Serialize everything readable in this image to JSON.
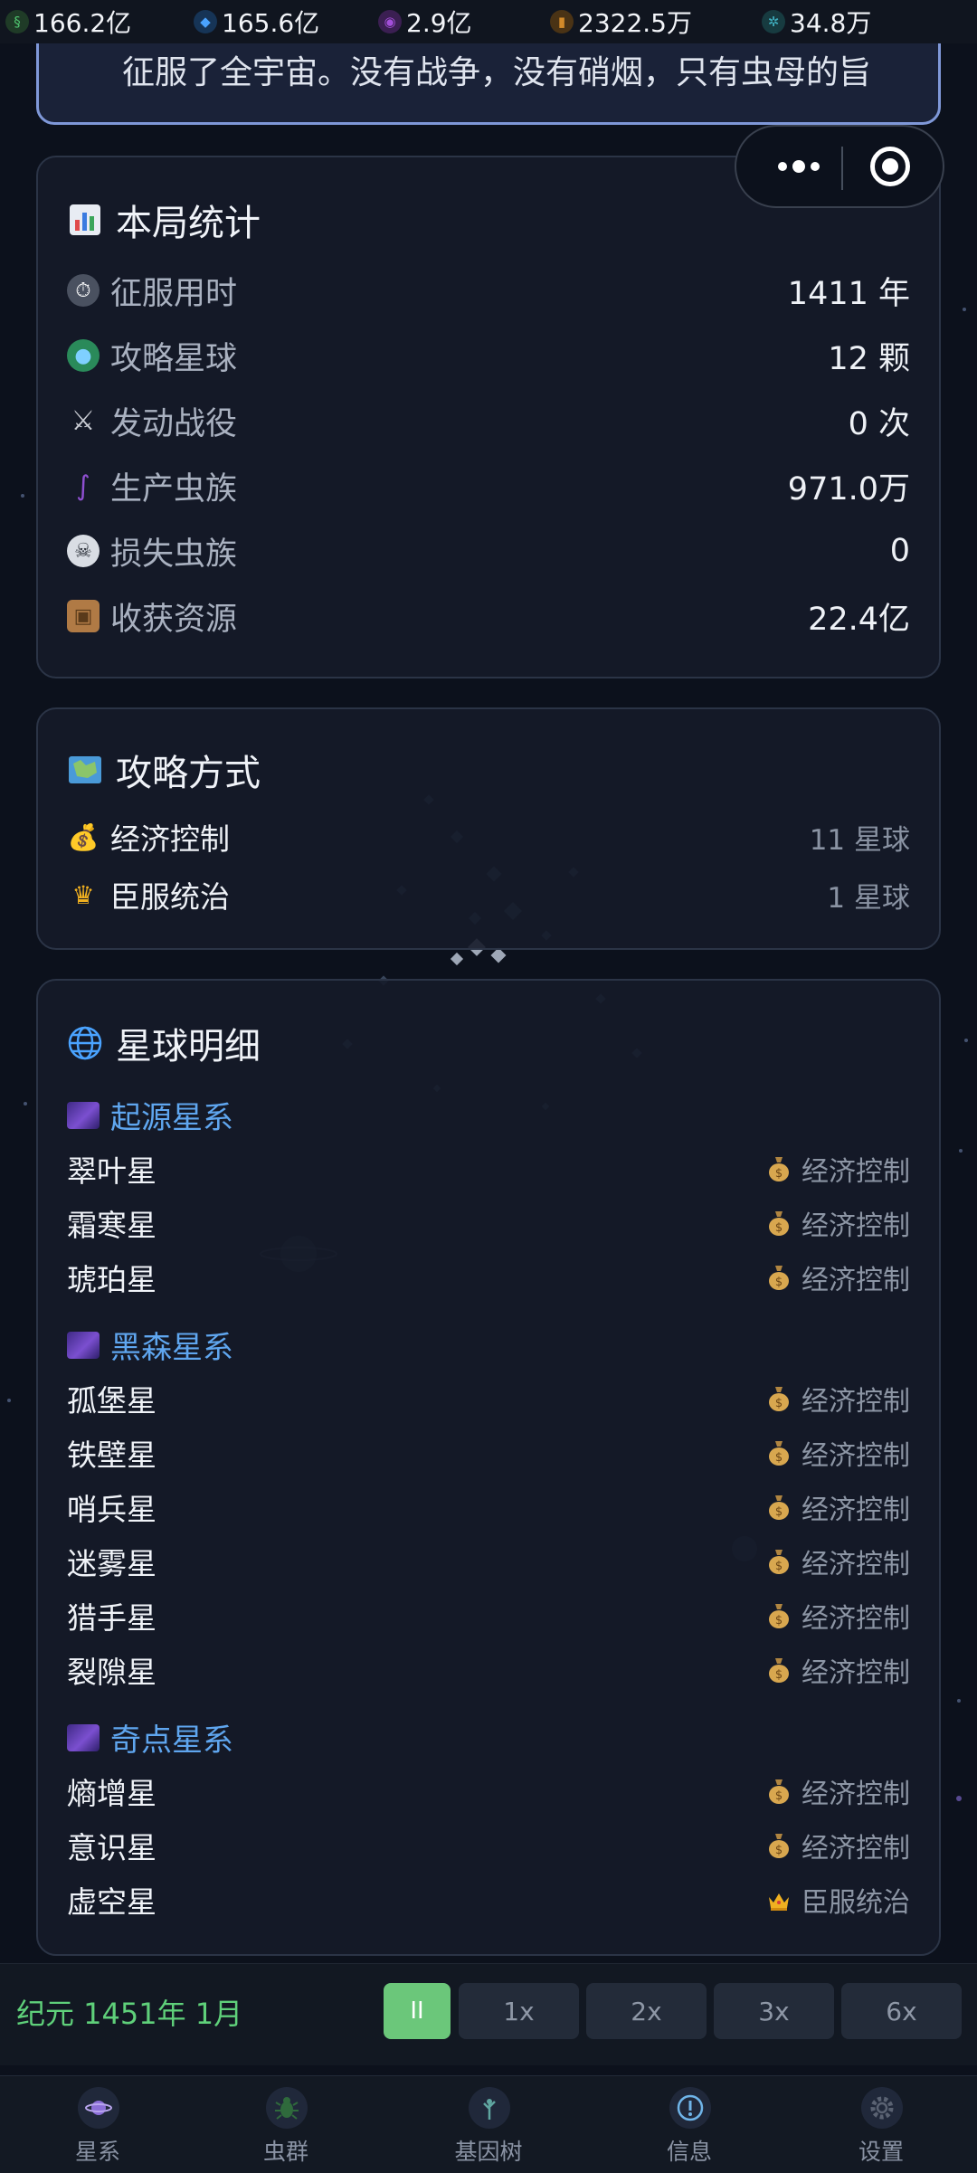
{
  "resources": [
    {
      "icon": "dna-icon",
      "value": "166.2亿",
      "color": "#4fc46f"
    },
    {
      "icon": "crystal-icon",
      "value": "165.6亿",
      "color": "#4aa3ff"
    },
    {
      "icon": "essence-icon",
      "value": "2.9亿",
      "color": "#a34fd9"
    },
    {
      "icon": "mineral-icon",
      "value": "2322.5万",
      "color": "#d28a2a"
    },
    {
      "icon": "gear-resource-icon",
      "value": "34.8万",
      "color": "#3fb0c0"
    }
  ],
  "quote": {
    "text": "征服了全宇宙。没有战争，没有硝烟，只有虫母的旨"
  },
  "stats": {
    "title": "本局统计",
    "rows": [
      {
        "icon": "stopwatch-icon",
        "label": "征服用时",
        "value": "1411 年"
      },
      {
        "icon": "globe-icon",
        "label": "攻略星球",
        "value": "12 颗"
      },
      {
        "icon": "swords-icon",
        "label": "发动战役",
        "value": "0 次"
      },
      {
        "icon": "worm-icon",
        "label": "生产虫族",
        "value": "971.0万"
      },
      {
        "icon": "skull-icon",
        "label": "损失虫族",
        "value": "0"
      },
      {
        "icon": "package-icon",
        "label": "收获资源",
        "value": "22.4亿"
      }
    ]
  },
  "methods": {
    "title": "攻略方式",
    "rows": [
      {
        "icon": "money-bag-icon",
        "label": "经济控制",
        "value": "11 星球"
      },
      {
        "icon": "crown-icon",
        "label": "臣服统治",
        "value": "1 星球"
      }
    ]
  },
  "planets": {
    "title": "星球明细",
    "systems": [
      {
        "name": "起源星系",
        "planets": [
          {
            "name": "翠叶星",
            "method": "经济控制",
            "icon": "money-bag-icon"
          },
          {
            "name": "霜寒星",
            "method": "经济控制",
            "icon": "money-bag-icon"
          },
          {
            "name": "琥珀星",
            "method": "经济控制",
            "icon": "money-bag-icon"
          }
        ]
      },
      {
        "name": "黑森星系",
        "planets": [
          {
            "name": "孤堡星",
            "method": "经济控制",
            "icon": "money-bag-icon"
          },
          {
            "name": "铁壁星",
            "method": "经济控制",
            "icon": "money-bag-icon"
          },
          {
            "name": "哨兵星",
            "method": "经济控制",
            "icon": "money-bag-icon"
          },
          {
            "name": "迷雾星",
            "method": "经济控制",
            "icon": "money-bag-icon"
          },
          {
            "name": "猎手星",
            "method": "经济控制",
            "icon": "money-bag-icon"
          },
          {
            "name": "裂隙星",
            "method": "经济控制",
            "icon": "money-bag-icon"
          }
        ]
      },
      {
        "name": "奇点星系",
        "planets": [
          {
            "name": "熵增星",
            "method": "经济控制",
            "icon": "money-bag-icon"
          },
          {
            "name": "意识星",
            "method": "经济控制",
            "icon": "money-bag-icon"
          },
          {
            "name": "虚空星",
            "method": "臣服统治",
            "icon": "crown-icon"
          }
        ]
      }
    ]
  },
  "controls": {
    "era": "纪元 1451年 1月",
    "pause_label": "II",
    "speeds": [
      "1x",
      "2x",
      "3x",
      "6x"
    ]
  },
  "tabs": [
    {
      "label": "星系",
      "icon": "planet-icon"
    },
    {
      "label": "虫群",
      "icon": "bug-icon"
    },
    {
      "label": "基因树",
      "icon": "gene-tree-icon"
    },
    {
      "label": "信息",
      "icon": "info-icon"
    },
    {
      "label": "设置",
      "icon": "settings-icon"
    }
  ]
}
